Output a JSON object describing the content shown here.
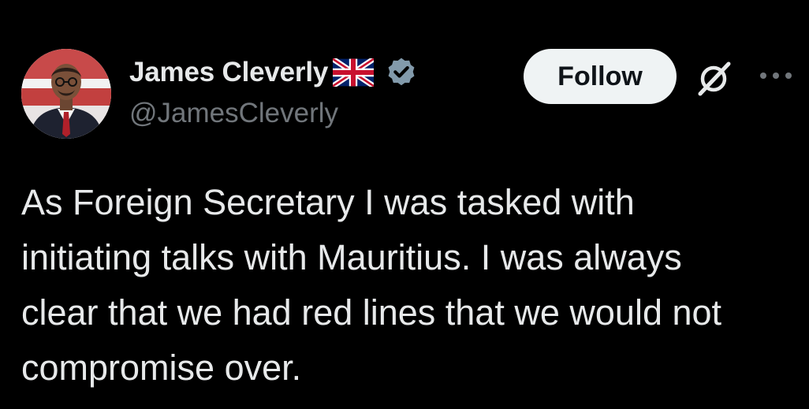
{
  "tweet": {
    "author": {
      "display_name": "James Cleverly",
      "handle": "@JamesCleverly",
      "flag_icon": "uk-flag-icon",
      "verified_icon": "verified-badge-icon",
      "verified_color": "#829aab"
    },
    "actions": {
      "follow_label": "Follow",
      "grok_icon": "grok-icon",
      "more_icon": "more-options-icon"
    },
    "text": "As Foreign Secretary I was tasked with\ninitiating talks with Mauritius. I was always\nclear that we had red lines that we would not\ncompromise over."
  },
  "colors": {
    "background": "#000000",
    "primary_text": "#e7e9ea",
    "secondary_text": "#71767b",
    "follow_bg": "#eff3f4"
  }
}
